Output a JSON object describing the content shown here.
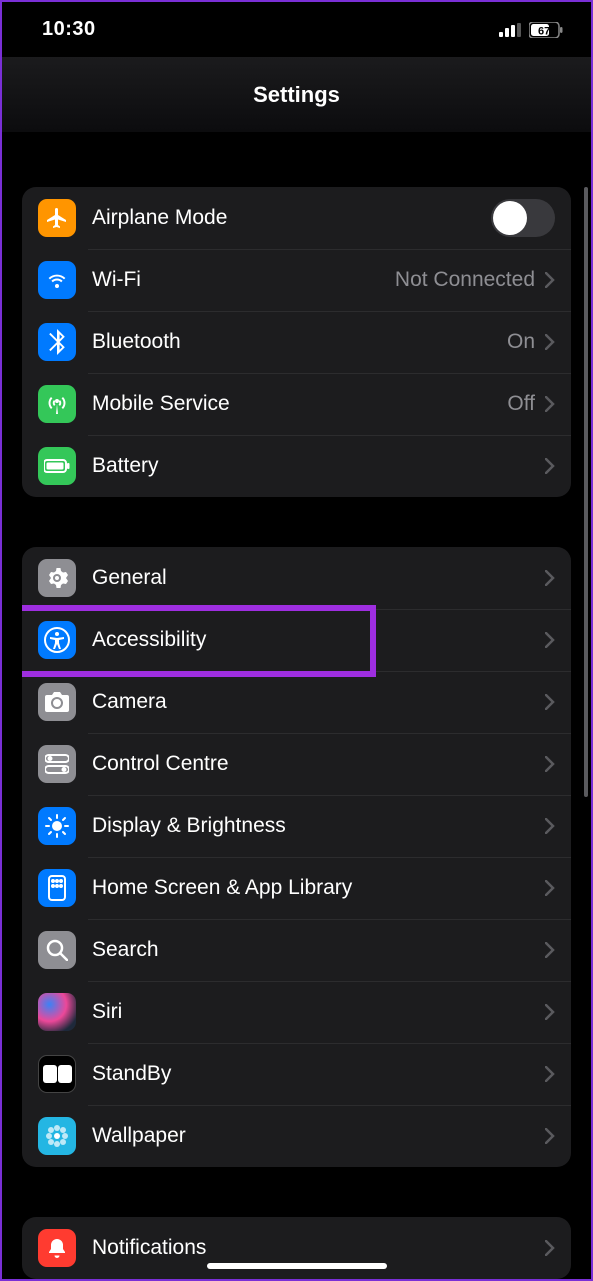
{
  "status": {
    "time": "10:30",
    "battery": "67"
  },
  "header": {
    "title": "Settings"
  },
  "group1": {
    "airplane": {
      "label": "Airplane Mode"
    },
    "wifi": {
      "label": "Wi-Fi",
      "value": "Not Connected"
    },
    "bluetooth": {
      "label": "Bluetooth",
      "value": "On"
    },
    "mobile": {
      "label": "Mobile Service",
      "value": "Off"
    },
    "battery": {
      "label": "Battery"
    }
  },
  "group2": {
    "general": {
      "label": "General"
    },
    "accessibility": {
      "label": "Accessibility"
    },
    "camera": {
      "label": "Camera"
    },
    "controlcentre": {
      "label": "Control Centre"
    },
    "display": {
      "label": "Display & Brightness"
    },
    "homescreen": {
      "label": "Home Screen & App Library"
    },
    "search": {
      "label": "Search"
    },
    "siri": {
      "label": "Siri"
    },
    "standby": {
      "label": "StandBy"
    },
    "wallpaper": {
      "label": "Wallpaper"
    }
  },
  "group3": {
    "notifications": {
      "label": "Notifications"
    }
  },
  "colors": {
    "orange": "#ff9500",
    "blue": "#007aff",
    "green": "#34c759",
    "gray": "#8e8e93",
    "red": "#ff3b30"
  }
}
